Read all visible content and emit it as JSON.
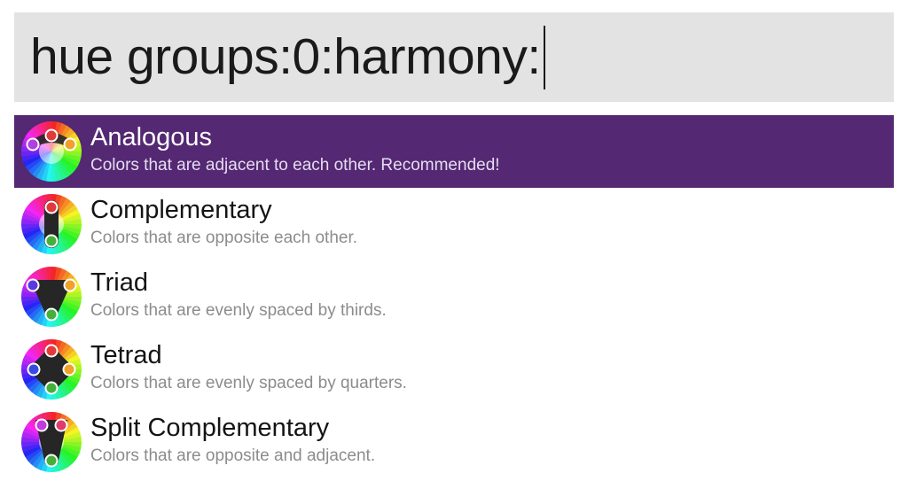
{
  "search": {
    "query": "hue groups:0:harmony:"
  },
  "results": [
    {
      "title": "Analogous",
      "subtitle": "Colors that are adjacent to each other. Recommended!",
      "icon": "analogous-harmony-icon",
      "selected": true
    },
    {
      "title": "Complementary",
      "subtitle": "Colors that are opposite each other.",
      "icon": "complementary-harmony-icon",
      "selected": false
    },
    {
      "title": "Triad",
      "subtitle": "Colors that are evenly spaced by thirds.",
      "icon": "triad-harmony-icon",
      "selected": false
    },
    {
      "title": "Tetrad",
      "subtitle": "Colors that are evenly spaced by quarters.",
      "icon": "tetrad-harmony-icon",
      "selected": false
    },
    {
      "title": "Split Complementary",
      "subtitle": "Colors that are opposite and adjacent.",
      "icon": "split-complementary-harmony-icon",
      "selected": false
    }
  ],
  "colors": {
    "selection": "#542873",
    "search_background": "#e3e3e3"
  }
}
